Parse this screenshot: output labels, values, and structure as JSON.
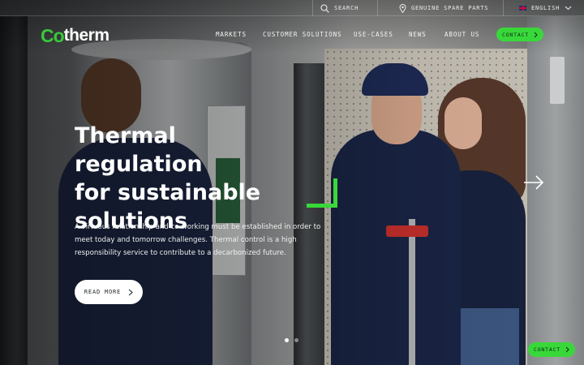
{
  "brand": {
    "logo_mark": "Co",
    "logo_rest": "therm",
    "accent_color": "#39d83a"
  },
  "utility_bar": {
    "search_label": "SEARCH",
    "search_icon": "search-icon",
    "spare_parts_label": "GENUINE SPARE PARTS",
    "spare_parts_icon": "location-pin-icon",
    "language_label": "ENGLISH",
    "language_icon": "uk-flag-icon"
  },
  "nav": {
    "items": [
      {
        "label": "MARKETS"
      },
      {
        "label": "CUSTOMER SOLUTIONS"
      },
      {
        "label": "USE-CASES"
      },
      {
        "label": "NEWS"
      },
      {
        "label": "ABOUT US"
      }
    ],
    "contact_label": "CONTACT"
  },
  "hero": {
    "title_line1": "Thermal regulation",
    "title_line2": "for sustainable",
    "title_line3": "solutions",
    "description": "A virtuous relationship and co-working must be established in order to meet today and tomorrow challenges. Thermal control is a high responsibility service to contribute to a decarbonized future.",
    "cta_label": "READ MORE",
    "slide_count": 2,
    "active_slide": 1
  },
  "floating": {
    "contact_label": "CONTACT"
  }
}
